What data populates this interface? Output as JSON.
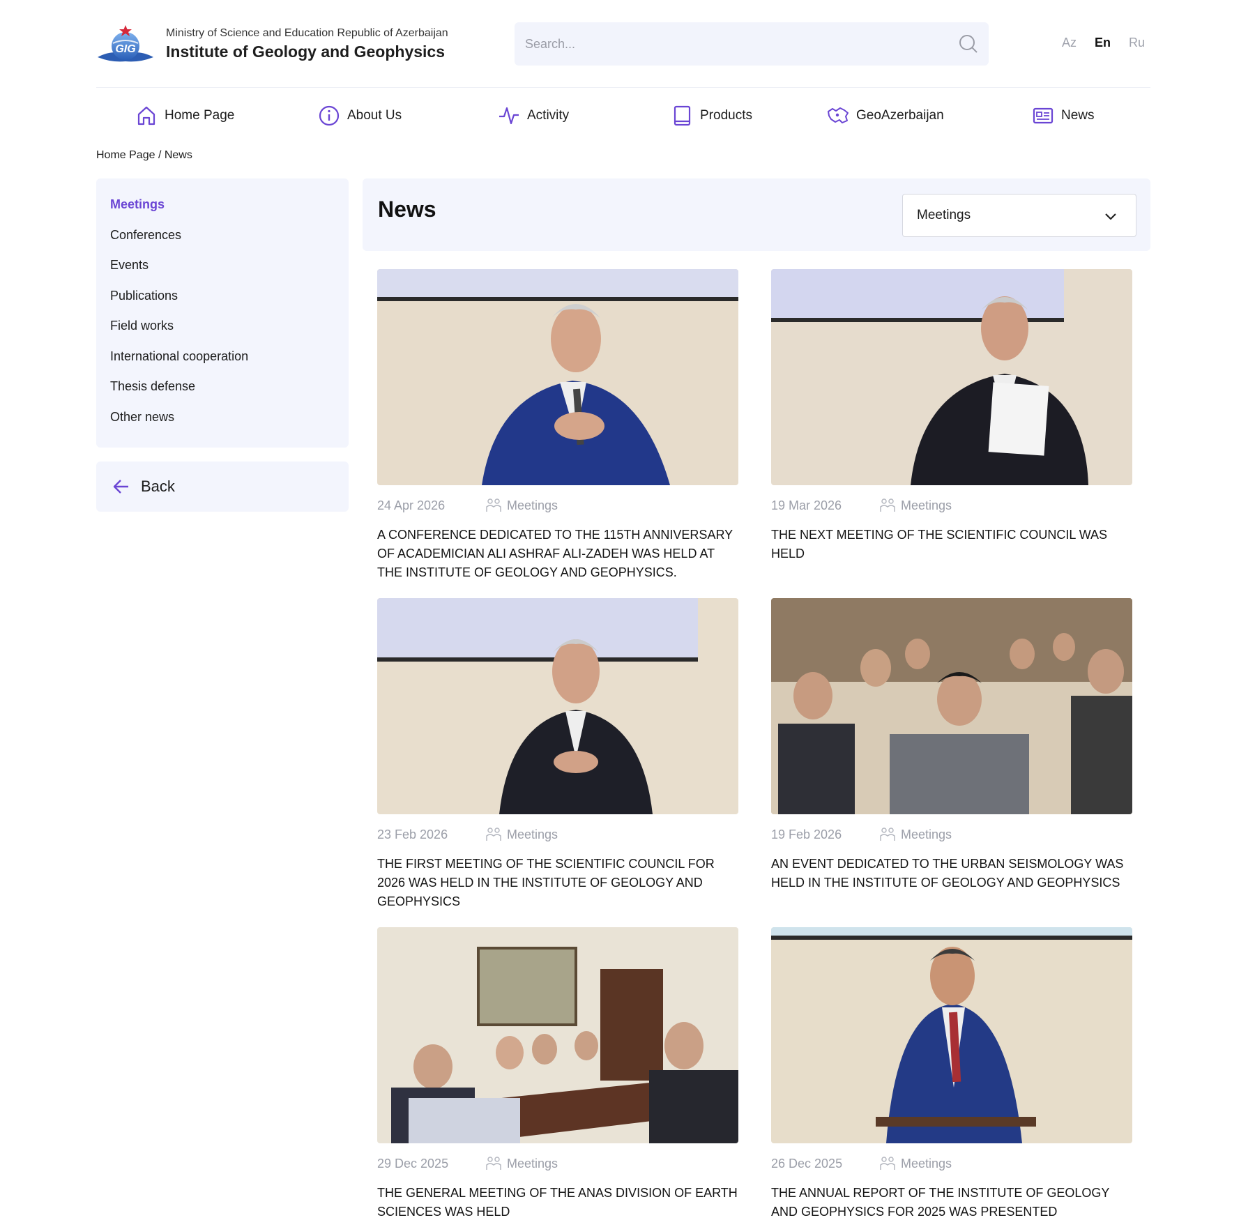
{
  "header": {
    "ministry": "Ministry of Science and Education Republic of Azerbaijan",
    "institute": "Institute of Geology and Geophysics",
    "logo_text": "GIG",
    "search_placeholder": "Search...",
    "languages": [
      {
        "label": "Az",
        "active": false
      },
      {
        "label": "En",
        "active": true
      },
      {
        "label": "Ru",
        "active": false
      }
    ]
  },
  "nav": {
    "items": [
      {
        "label": "Home Page",
        "icon": "home-icon"
      },
      {
        "label": "About Us",
        "icon": "info-icon"
      },
      {
        "label": "Activity",
        "icon": "activity-icon"
      },
      {
        "label": "Products",
        "icon": "book-icon"
      },
      {
        "label": "GeoAzerbaijan",
        "icon": "map-icon"
      },
      {
        "label": "News",
        "icon": "newspaper-icon"
      }
    ]
  },
  "breadcrumb": "Home Page / News",
  "sidebar": {
    "items": [
      {
        "label": "Meetings",
        "active": true
      },
      {
        "label": "Conferences",
        "active": false
      },
      {
        "label": "Events",
        "active": false
      },
      {
        "label": "Publications",
        "active": false
      },
      {
        "label": "Field works",
        "active": false
      },
      {
        "label": "International cooperation",
        "active": false
      },
      {
        "label": "Thesis defense",
        "active": false
      },
      {
        "label": "Other news",
        "active": false
      }
    ],
    "back_label": "Back"
  },
  "main": {
    "title": "News",
    "category_select": "Meetings"
  },
  "colors": {
    "accent": "#6a45d4",
    "panel_bg": "#f3f5fd",
    "muted": "#9b9ea8"
  },
  "news": [
    {
      "date": "24 Apr 2026",
      "category": "Meetings",
      "title": "A CONFERENCE DEDICATED TO THE 115TH ANNIVERSARY OF ACADEMICIAN ALI ASHRAF ALI-ZADEH WAS HELD AT THE INSTITUTE OF GEOLOGY AND GEOPHYSICS."
    },
    {
      "date": "19 Mar 2026",
      "category": "Meetings",
      "title": "THE NEXT MEETING OF THE SCIENTIFIC COUNCIL WAS HELD"
    },
    {
      "date": "23 Feb 2026",
      "category": "Meetings",
      "title": "THE FIRST MEETING OF THE SCIENTIFIC COUNCIL FOR 2026 WAS HELD IN THE INSTITUTE OF GEOLOGY AND GEOPHYSICS"
    },
    {
      "date": "19 Feb 2026",
      "category": "Meetings",
      "title": "AN EVENT DEDICATED TO THE URBAN SEISMOLOGY WAS HELD IN THE INSTITUTE OF GEOLOGY AND GEOPHYSICS"
    },
    {
      "date": "29 Dec 2025",
      "category": "Meetings",
      "title": "THE GENERAL MEETING OF THE ANAS DIVISION OF EARTH SCIENCES WAS HELD"
    },
    {
      "date": "26 Dec 2025",
      "category": "Meetings",
      "title": "THE ANNUAL REPORT OF THE INSTITUTE OF GEOLOGY AND GEOPHYSICS FOR 2025 WAS PRESENTED"
    }
  ]
}
